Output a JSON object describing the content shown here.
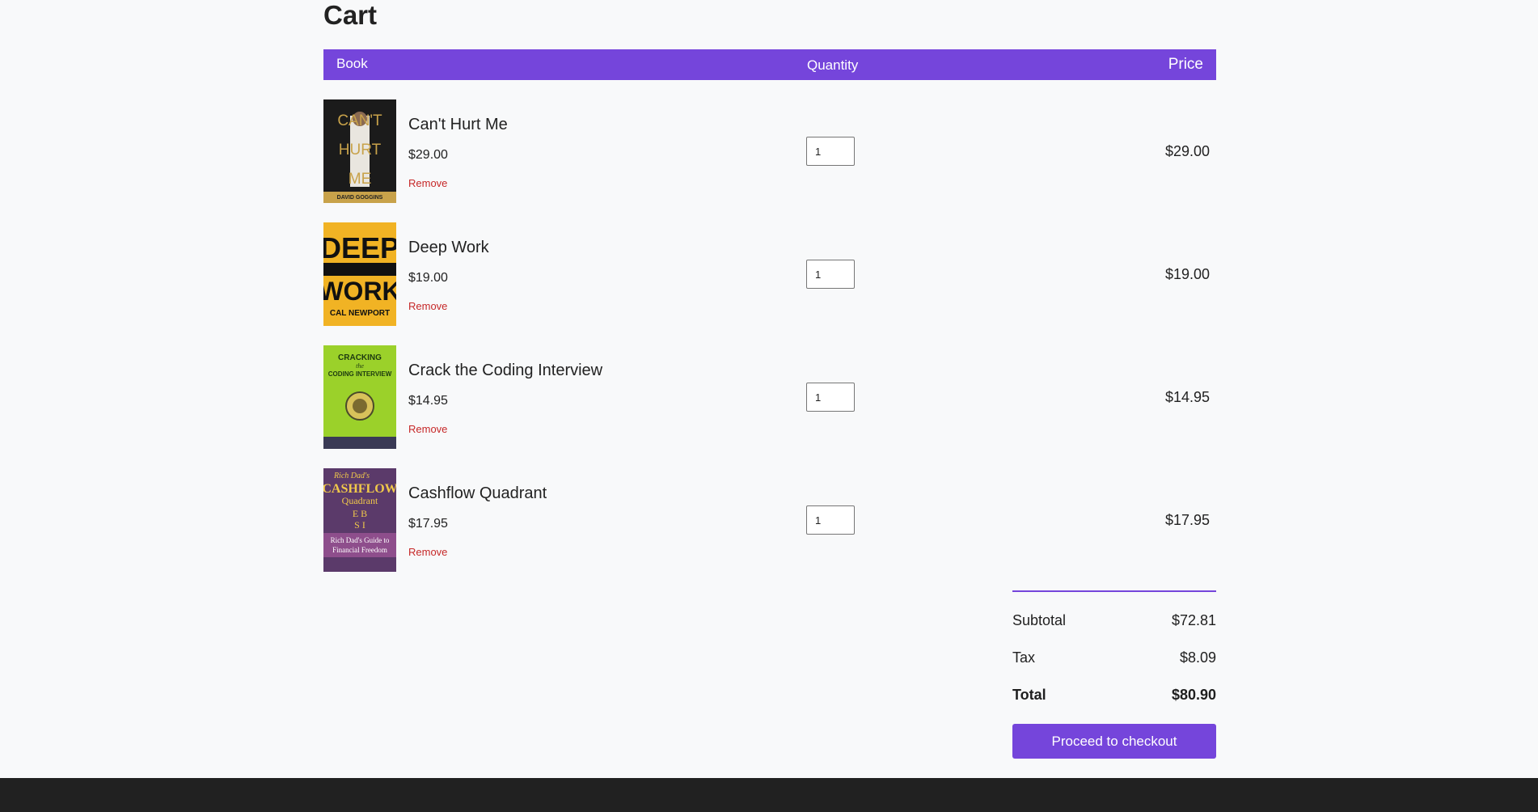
{
  "page": {
    "title": "Cart"
  },
  "table": {
    "headers": {
      "book": "Book",
      "quantity": "Quantity",
      "price": "Price"
    }
  },
  "items": [
    {
      "title": "Can't Hurt Me",
      "unit_price": "$29.00",
      "remove_label": "Remove",
      "quantity": "1",
      "line_price": "$29.00",
      "cover": {
        "lines": [
          "CAN'T",
          "HURT",
          "ME"
        ],
        "author": "DAVID GOGGINS"
      }
    },
    {
      "title": "Deep Work",
      "unit_price": "$19.00",
      "remove_label": "Remove",
      "quantity": "1",
      "line_price": "$19.00",
      "cover": {
        "lines": [
          "DEEP",
          "WORK"
        ],
        "author": "CAL NEWPORT"
      }
    },
    {
      "title": "Crack the Coding Interview",
      "unit_price": "$14.95",
      "remove_label": "Remove",
      "quantity": "1",
      "line_price": "$14.95",
      "cover": {
        "lines": [
          "CRACKING",
          "the",
          "CODING INTERVIEW"
        ]
      }
    },
    {
      "title": "Cashflow Quadrant",
      "unit_price": "$17.95",
      "remove_label": "Remove",
      "quantity": "1",
      "line_price": "$17.95",
      "cover": {
        "lines": [
          "Rich Dad's",
          "CASHFLOW",
          "Quadrant",
          "E B",
          "S I",
          "Rich Dad's Guide to",
          "Financial Freedom"
        ]
      }
    }
  ],
  "summary": {
    "subtotal_label": "Subtotal",
    "subtotal": "$72.81",
    "tax_label": "Tax",
    "tax": "$8.09",
    "total_label": "Total",
    "total": "$80.90",
    "checkout_label": "Proceed to checkout"
  },
  "colors": {
    "accent": "#7545db",
    "remove": "#c62828",
    "footer": "#212121"
  }
}
